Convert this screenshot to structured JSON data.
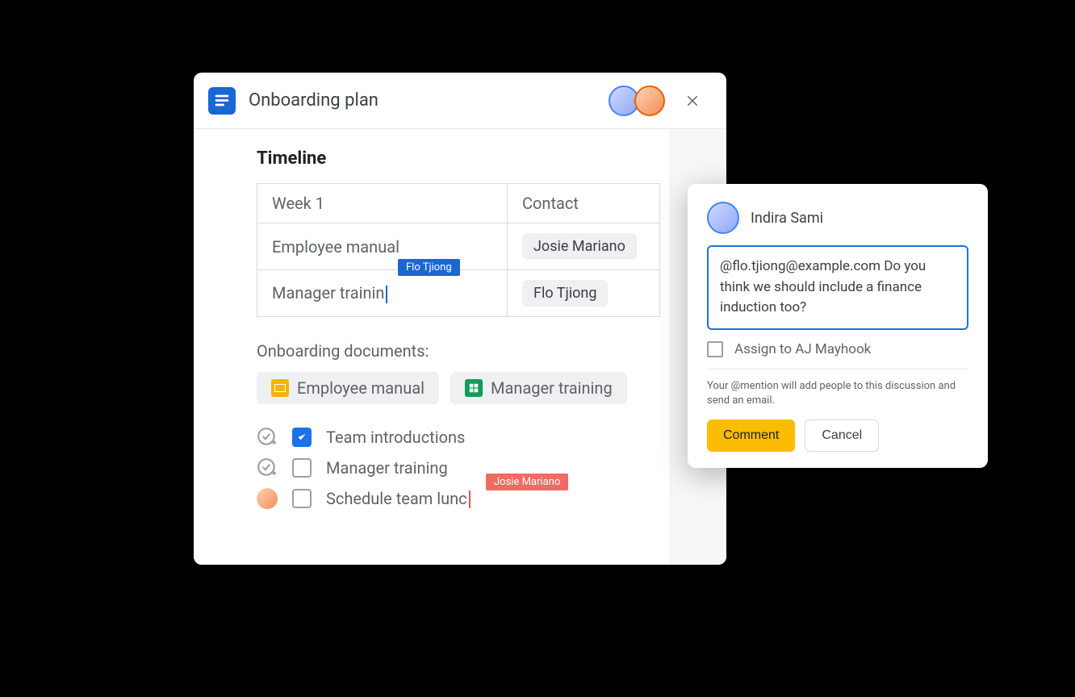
{
  "header": {
    "title": "Onboarding plan"
  },
  "section": {
    "title": "Timeline"
  },
  "table": {
    "head_col1": "Week 1",
    "head_col2": "Contact",
    "row1_col1": "Employee manual",
    "row1_contact": "Josie Mariano",
    "row2_col1_partial": "Manager trainin",
    "row2_contact": "Flo Tjiong",
    "edit_cursor_name": "Flo Tjiong"
  },
  "docs": {
    "label": "Onboarding documents:",
    "chip1": "Employee manual",
    "chip2": "Manager training"
  },
  "tasks": {
    "t1": "Team introductions",
    "t2": "Manager training",
    "t3_partial": "Schedule team lunc",
    "t3_cursor_name": "Josie Mariano"
  },
  "comment": {
    "author": "Indira Sami",
    "text": "@flo.tjiong@example.com Do you think we should include a finance induction too?",
    "assign_label": "Assign to AJ Mayhook",
    "hint": "Your @mention will add people to this discussion and send an email.",
    "primary": "Comment",
    "secondary": "Cancel"
  }
}
